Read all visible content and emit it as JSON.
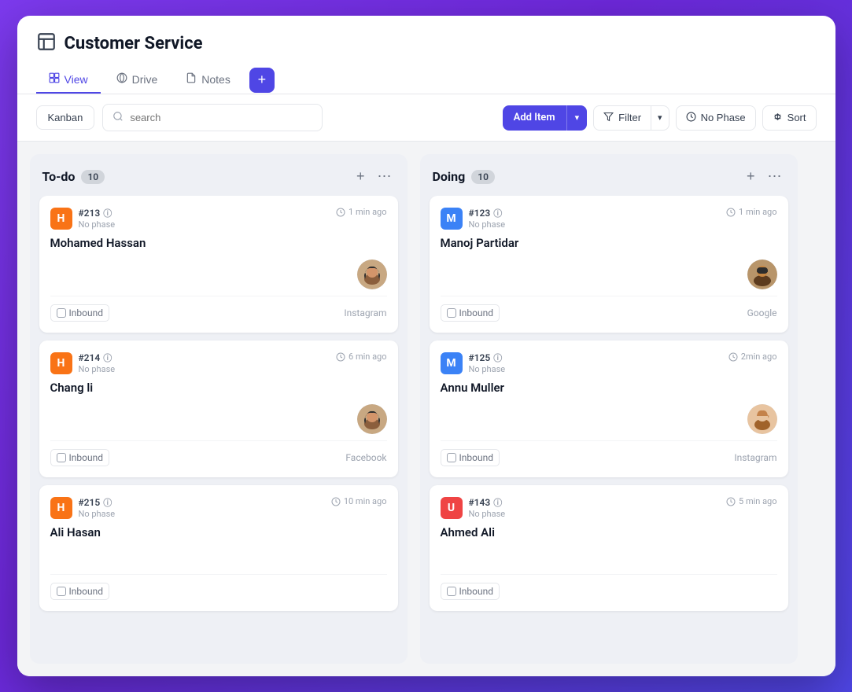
{
  "app": {
    "title": "Customer Service",
    "header_icon": "table-icon"
  },
  "tabs": [
    {
      "id": "view",
      "label": "View",
      "icon": "view-icon",
      "active": true
    },
    {
      "id": "drive",
      "label": "Drive",
      "icon": "drive-icon",
      "active": false
    },
    {
      "id": "notes",
      "label": "Notes",
      "icon": "notes-icon",
      "active": false
    }
  ],
  "toolbar": {
    "kanban_label": "Kanban",
    "search_placeholder": "search",
    "add_item_label": "Add Item",
    "filter_label": "Filter",
    "no_phase_label": "No Phase",
    "sort_label": "Sort"
  },
  "columns": [
    {
      "id": "todo",
      "title": "To-do",
      "count": 10,
      "cards": [
        {
          "id": "#213",
          "phase": "No phase",
          "time": "1 min ago",
          "name": "Mohamed Hassan",
          "avatar_color": "orange",
          "avatar_letter": "H",
          "source_tag": "Inbound",
          "source": "Instagram",
          "has_assignee": true,
          "assignee_style": "hijab-woman-1"
        },
        {
          "id": "#214",
          "phase": "No phase",
          "time": "6 min ago",
          "name": "Chang li",
          "avatar_color": "orange",
          "avatar_letter": "H",
          "source_tag": "Inbound",
          "source": "Facebook",
          "has_assignee": true,
          "assignee_style": "hijab-woman-2"
        },
        {
          "id": "#215",
          "phase": "No phase",
          "time": "10 min ago",
          "name": "Ali Hasan",
          "avatar_color": "orange",
          "avatar_letter": "H",
          "source_tag": "Inbound",
          "source": "",
          "has_assignee": false,
          "assignee_style": ""
        }
      ]
    },
    {
      "id": "doing",
      "title": "Doing",
      "count": 10,
      "cards": [
        {
          "id": "#123",
          "phase": "No phase",
          "time": "1 min ago",
          "name": "Manoj Partidar",
          "avatar_color": "blue",
          "avatar_letter": "M",
          "source_tag": "Inbound",
          "source": "Google",
          "has_assignee": true,
          "assignee_style": "man-1"
        },
        {
          "id": "#125",
          "phase": "No phase",
          "time": "2min ago",
          "name": "Annu Muller",
          "avatar_color": "blue",
          "avatar_letter": "M",
          "source_tag": "Inbound",
          "source": "Instagram",
          "has_assignee": true,
          "assignee_style": "woman-1"
        },
        {
          "id": "#143",
          "phase": "No phase",
          "time": "5 min ago",
          "name": "Ahmed Ali",
          "avatar_color": "red",
          "avatar_letter": "U",
          "source_tag": "Inbound",
          "source": "",
          "has_assignee": false,
          "assignee_style": ""
        }
      ]
    }
  ]
}
